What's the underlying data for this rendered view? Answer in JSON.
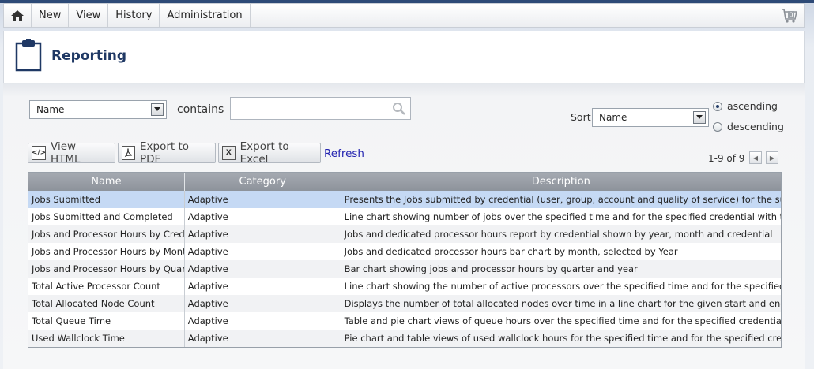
{
  "nav": {
    "items": [
      {
        "label": "New"
      },
      {
        "label": "View"
      },
      {
        "label": "History"
      },
      {
        "label": "Administration"
      }
    ],
    "cart_count": "0"
  },
  "header": {
    "title": "Reporting"
  },
  "filter": {
    "field_selected": "Name",
    "operator_label": "contains",
    "search_value": "",
    "search_placeholder": ""
  },
  "sort": {
    "label": "Sort",
    "selected": "Name",
    "ascending_label": "ascending",
    "descending_label": "descending",
    "direction": "ascending"
  },
  "toolbar": {
    "view_html_label": "View HTML",
    "export_pdf_label": "Export to PDF",
    "export_excel_label": "Export to Excel",
    "refresh_label": "Refresh"
  },
  "pager": {
    "range_text": "1-9 of 9"
  },
  "table": {
    "columns": [
      "Name",
      "Category",
      "Description"
    ],
    "selected_row": 0,
    "rows": [
      [
        "Jobs Submitted",
        "Adaptive",
        "Presents the Jobs submitted by credential (user, group, account and quality of service) for the supplied time"
      ],
      [
        "Jobs Submitted and Completed",
        "Adaptive",
        "Line chart showing number of jobs over the specified time and for the specified credential with the option of"
      ],
      [
        "Jobs and Processor Hours by Credential",
        "Adaptive",
        "Jobs and dedicated processor hours report by credential shown by year, month and credential"
      ],
      [
        "Jobs and Processor Hours by Month",
        "Adaptive",
        "Jobs and dedicated processor hours bar chart by month, selected by Year"
      ],
      [
        "Jobs and Processor Hours by Quarter",
        "Adaptive",
        "Bar chart showing jobs and processor hours by quarter and year"
      ],
      [
        "Total Active Processor Count",
        "Adaptive",
        "Line chart showing the number of active processors over the specified time and for the specified credential"
      ],
      [
        "Total Allocated Node Count",
        "Adaptive",
        "Displays the number of total allocated nodes over time in a line chart for the given start and end time by cre"
      ],
      [
        "Total Queue Time",
        "Adaptive",
        "Table and pie chart views of queue hours over the specified time and for the specified credential (user, grou"
      ],
      [
        "Used Wallclock Time",
        "Adaptive",
        "Pie chart and table views of used wallclock hours for the specified time and for the specified credential (user"
      ]
    ]
  },
  "colors": {
    "title": "#1f3864",
    "header_bar": "#8d939b",
    "selected_row": "#c5d9f4",
    "link": "#2424b0"
  }
}
